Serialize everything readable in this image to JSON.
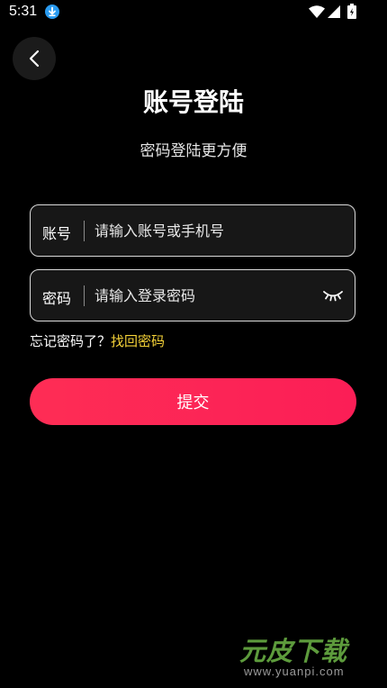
{
  "status_bar": {
    "time": "5:31",
    "icons": [
      "download-icon",
      "wifi-icon",
      "signal-icon",
      "battery-icon"
    ]
  },
  "header": {
    "back_icon": "chevron-left-icon",
    "title": "账号登陆",
    "subtitle": "密码登陆更方便"
  },
  "form": {
    "account": {
      "label": "账号",
      "placeholder": "请输入账号或手机号"
    },
    "password": {
      "label": "密码",
      "placeholder": "请输入登录密码",
      "toggle_icon": "eye-closed-icon"
    },
    "forgot": {
      "text": "忘记密码了？",
      "link": "找回密码"
    },
    "submit_label": "提交"
  },
  "watermark": {
    "logo": "元皮下载",
    "url": "www.yuanpi.com"
  },
  "colors": {
    "background": "#000000",
    "field_bg": "#171717",
    "accent": "#fe2d55",
    "link": "#f5d238"
  }
}
